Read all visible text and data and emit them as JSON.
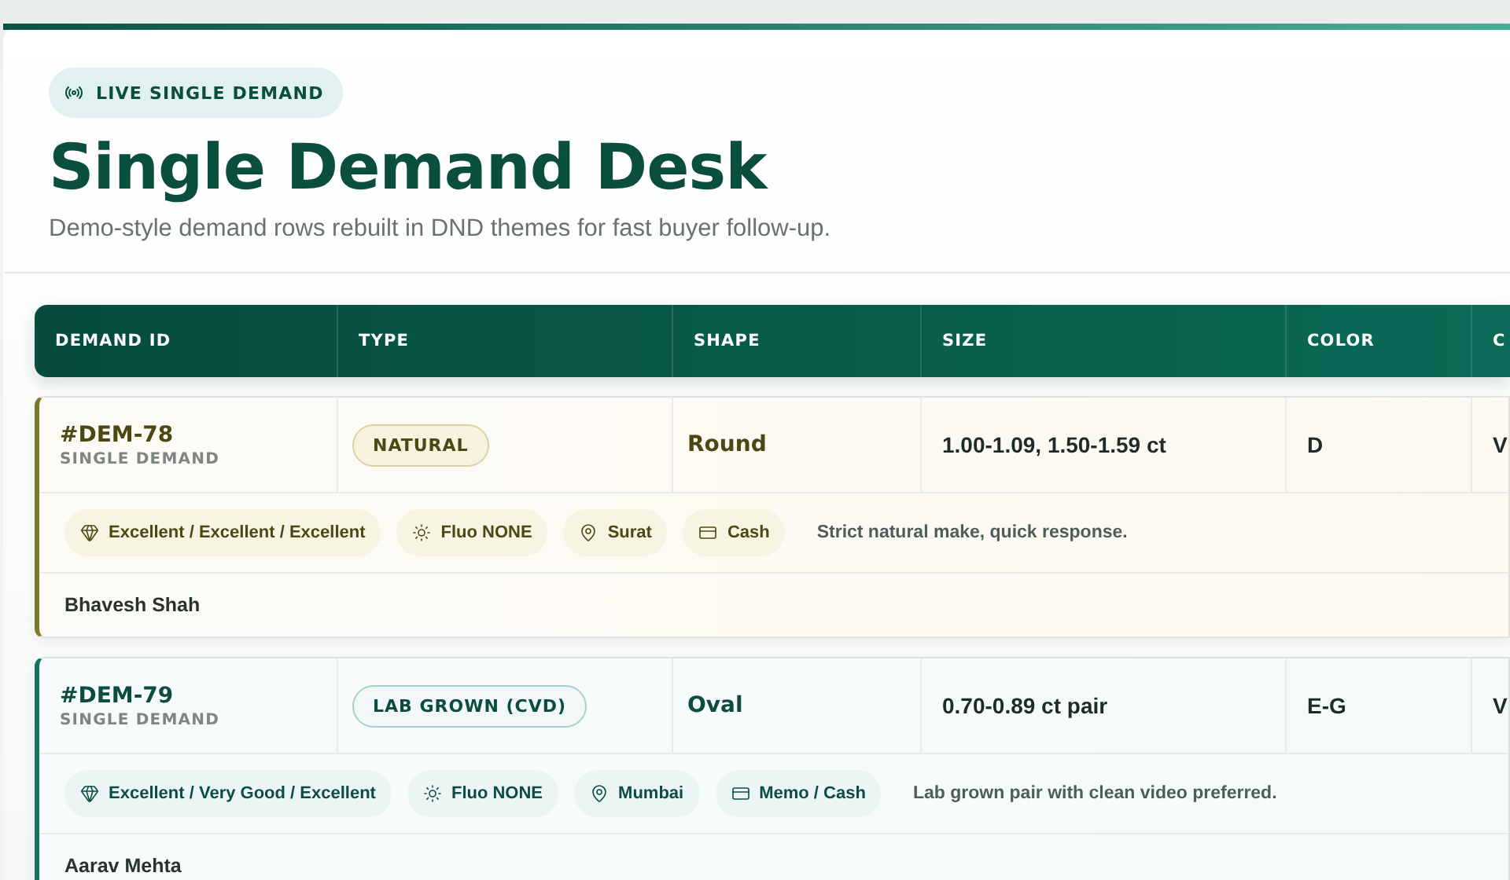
{
  "badge": {
    "label": "LIVE SINGLE DEMAND"
  },
  "title": "Single Demand Desk",
  "subtitle": "Demo-style demand rows rebuilt in DND themes for fast buyer follow-up.",
  "table": {
    "columns": [
      "DEMAND ID",
      "TYPE",
      "SHAPE",
      "SIZE",
      "COLOR",
      "C"
    ],
    "rows": [
      {
        "kind": "natural",
        "id": "#DEM-78",
        "label": "SINGLE DEMAND",
        "type": "NATURAL",
        "shape": "Round",
        "size": "1.00-1.09, 1.50-1.59 ct",
        "color_grade": "D",
        "column_6": "V",
        "tags": [
          {
            "kind": "cut",
            "label": "Excellent / Excellent / Excellent"
          },
          {
            "kind": "fluo",
            "label": "Fluo NONE"
          },
          {
            "kind": "location",
            "label": "Surat"
          },
          {
            "kind": "payment",
            "label": "Cash"
          }
        ],
        "note": "Strict natural make, quick response.",
        "buyer": "Bhavesh Shah"
      },
      {
        "kind": "lab",
        "id": "#DEM-79",
        "label": "SINGLE DEMAND",
        "type": "LAB GROWN (CVD)",
        "shape": "Oval",
        "size": "0.70-0.89 ct pair",
        "color_grade": "E-G",
        "column_6": "V",
        "tags": [
          {
            "kind": "cut",
            "label": "Excellent / Very Good / Excellent"
          },
          {
            "kind": "fluo",
            "label": "Fluo NONE"
          },
          {
            "kind": "location",
            "label": "Mumbai"
          },
          {
            "kind": "payment",
            "label": "Memo / Cash"
          }
        ],
        "note": "Lab grown pair with clean video preferred.",
        "buyer": "Aarav Mehta"
      }
    ]
  }
}
